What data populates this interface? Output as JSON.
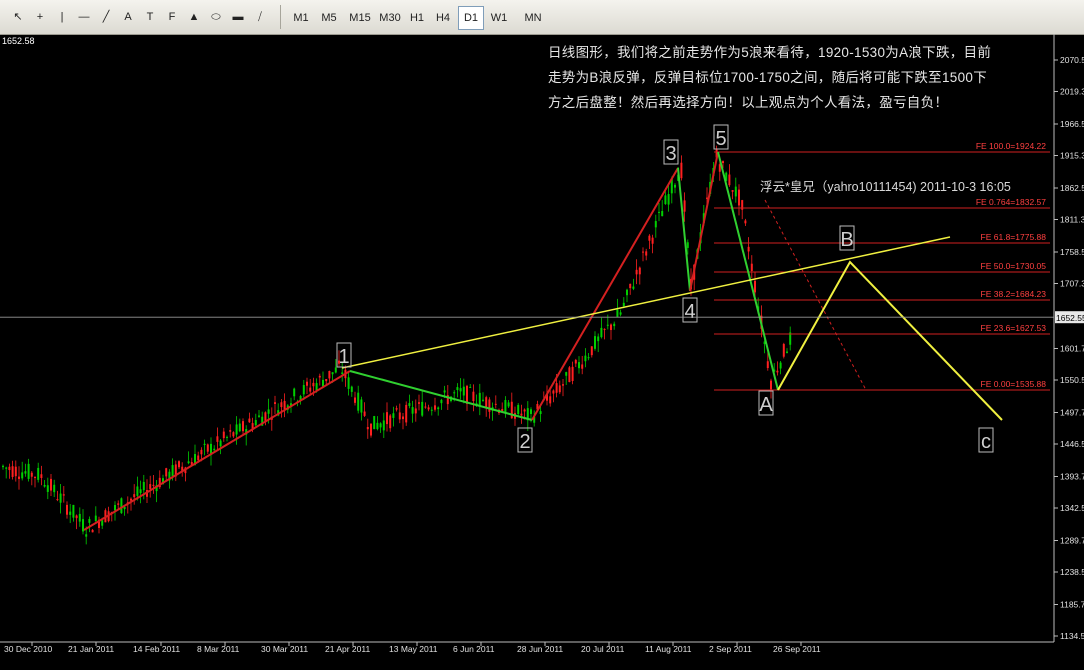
{
  "toolbar": {
    "tools": [
      "cursor-icon",
      "crosshair-icon",
      "vertical-line-icon",
      "horizontal-line-icon",
      "trendline-icon",
      "text-icon",
      "text-label-icon",
      "fibonacci-icon",
      "arrow-up-icon",
      "ellipse-icon",
      "rectangle-icon",
      "channel-icon",
      "drawing-dropdown-icon"
    ],
    "tool_glyphs": [
      "↖",
      "+",
      "|",
      "—",
      "╱",
      "A",
      "T",
      "F",
      "▲",
      "⬭",
      "▬",
      "⧸",
      "⇅"
    ],
    "timeframes": [
      "M1",
      "M5",
      "M15",
      "M30",
      "H1",
      "H4",
      "D1",
      "W1",
      "MN"
    ],
    "active_timeframe": "D1"
  },
  "chart": {
    "top_value": "1652.58",
    "background": "#000000",
    "up_color": "#00d000",
    "down_color": "#ff2020",
    "price_axis": [
      "2070.50",
      "2019.35",
      "1966.50",
      "1915.30",
      "1862.50",
      "1811.30",
      "1758.50",
      "1707.30",
      "1652.55",
      "1601.70",
      "1550.50",
      "1497.70",
      "1446.50",
      "1393.70",
      "1342.50",
      "1289.70",
      "1238.50",
      "1185.70",
      "1134.50"
    ],
    "current_price": "1652.55",
    "date_axis": [
      "30 Dec 2010",
      "21 Jan 2011",
      "14 Feb 2011",
      "8 Mar 2011",
      "30 Mar 2011",
      "21 Apr 2011",
      "13 May 2011",
      "6 Jun 2011",
      "28 Jun 2011",
      "20 Jul 2011",
      "11 Aug 2011",
      "2 Sep 2011",
      "26 Sep 2011"
    ],
    "fibo_levels": [
      "FE 100.0=1924.22",
      "FE 0.764=1832.57",
      "FE 61.8=1775.88",
      "FE 50.0=1730.05",
      "FE 38.2=1684.23",
      "FE 23.6=1627.53",
      "FE 0.00=1535.88"
    ],
    "wave_labels": [
      "1",
      "2",
      "3",
      "4",
      "5",
      "A",
      "B",
      "C"
    ],
    "wave_label_text": [
      "1",
      "2",
      "3",
      "4",
      "5",
      "A",
      "B",
      "c"
    ]
  },
  "note": {
    "lines": [
      "日线图形，我们将之前走势作为5浪来看待，1920-1530为A浪下跌，目前",
      "走势为B浪反弹，反弹目标位1700-1750之间，随后将可能下跌至1500下",
      "方之后盘整！然后再选择方向！以上观点为个人看法，盈亏自负！"
    ]
  },
  "signature": "浮云*皇兄（yahro10111454) 2011-10-3 16:05"
}
